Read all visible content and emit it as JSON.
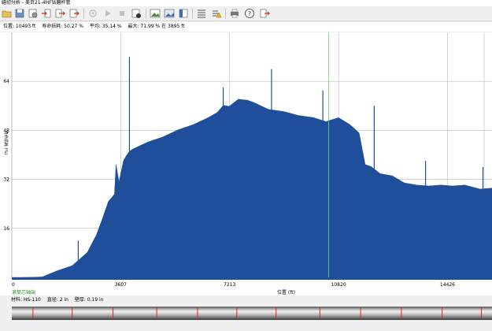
{
  "window": {
    "title": "缝纫分析 - 美页21-4HF钻磨杆管"
  },
  "toolbar": {
    "icons": [
      "open-icon",
      "save-icon",
      "settings-icon",
      "import-icon",
      "export-icon",
      "gear-disabled-icon",
      "play-icon",
      "stop-icon",
      "report-icon",
      "image-icon",
      "picture-icon",
      "layout-icon",
      "list-icon",
      "warning-icon",
      "print-icon",
      "help-icon",
      "exit-icon"
    ]
  },
  "status": {
    "position": "位置: 10493 ft",
    "life_loss": "寿命损耗: 50.27 %",
    "average": "平均: 35.14 %",
    "max": "最大: 71.99 % 在 3895 ft"
  },
  "chart_data": {
    "type": "area",
    "xlabel": "位置 (ft)",
    "ylabel": "寿命损耗 (%)",
    "xlim": [
      0,
      15900
    ],
    "ylim": [
      0,
      80
    ],
    "x_ticks": [
      0,
      3607,
      7213,
      10820,
      14426
    ],
    "y_ticks": [
      16,
      32,
      48,
      64
    ],
    "cursor_x": 10493,
    "grid": true,
    "series": [
      {
        "color": "#1f4e9a",
        "x": [
          0,
          1000,
          1050,
          1500,
          2000,
          2500,
          2800,
          3000,
          3200,
          3400,
          3450,
          3550,
          3607,
          3700,
          3800,
          3895,
          4000,
          4500,
          5000,
          5500,
          6000,
          6500,
          6800,
          7000,
          7200,
          7500,
          7800,
          8000,
          8500,
          9000,
          9500,
          10000,
          10400,
          10820,
          11200,
          11500,
          11700,
          11900,
          12200,
          12600,
          13000,
          13400,
          13800,
          14200,
          14600,
          15000,
          15500,
          15900
        ],
        "y": [
          0,
          0,
          0.5,
          2,
          4,
          8,
          14,
          19,
          25,
          27,
          37,
          31,
          34,
          38,
          40,
          41,
          42,
          44,
          46,
          48,
          50,
          52,
          54,
          56,
          56,
          58,
          58,
          57,
          55,
          54,
          53,
          52,
          51,
          52,
          50,
          47,
          37,
          36,
          34,
          33,
          31,
          30,
          30,
          30,
          30,
          30,
          29,
          29
        ]
      }
    ],
    "spikes": [
      {
        "x": 3895,
        "y": 72
      },
      {
        "x": 2200,
        "y": 12
      },
      {
        "x": 7000,
        "y": 62
      },
      {
        "x": 8600,
        "y": 68
      },
      {
        "x": 10300,
        "y": 61
      },
      {
        "x": 12000,
        "y": 56
      },
      {
        "x": 13700,
        "y": 38
      },
      {
        "x": 15600,
        "y": 36
      }
    ],
    "legend_link": "滚筒芯轴端"
  },
  "material": {
    "grade": "材料: HS-110",
    "diameter": "直径: 2 in",
    "wall": "壁厚: 0.19 in"
  },
  "pipe": {
    "marker_x": [
      700,
      2000,
      3350,
      4800,
      6150,
      7450,
      8750,
      10200,
      11550,
      12900,
      14250,
      15550
    ]
  }
}
